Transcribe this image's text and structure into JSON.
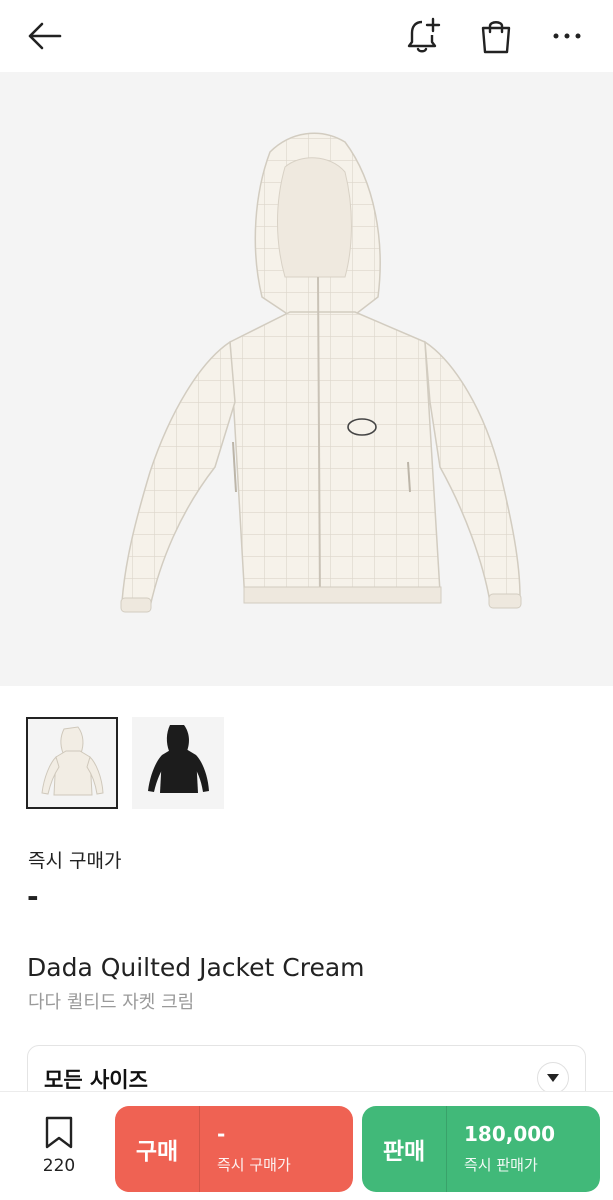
{
  "header": {
    "back_icon": "arrow-left-icon",
    "alert_icon": "bell-plus-icon",
    "cart_icon": "shopping-bag-icon",
    "more_icon": "more-horizontal-icon"
  },
  "gallery": {
    "thumbnails": [
      {
        "color": "cream",
        "selected": true
      },
      {
        "color": "black",
        "selected": false
      }
    ]
  },
  "product": {
    "price_label": "즉시 구매가",
    "price_value": "-",
    "name_en": "Dada Quilted Jacket Cream",
    "name_ko": "다다 퀼티드 자켓 크림"
  },
  "size_selector": {
    "label": "모든 사이즈"
  },
  "bottom": {
    "wish_count": "220",
    "buy": {
      "label": "구매",
      "price": "-",
      "sub": "즉시 구매가"
    },
    "sell": {
      "label": "판매",
      "price": "180,000",
      "sub": "즉시 판매가"
    }
  },
  "colors": {
    "buy": "#ef6253",
    "sell": "#41b979"
  }
}
